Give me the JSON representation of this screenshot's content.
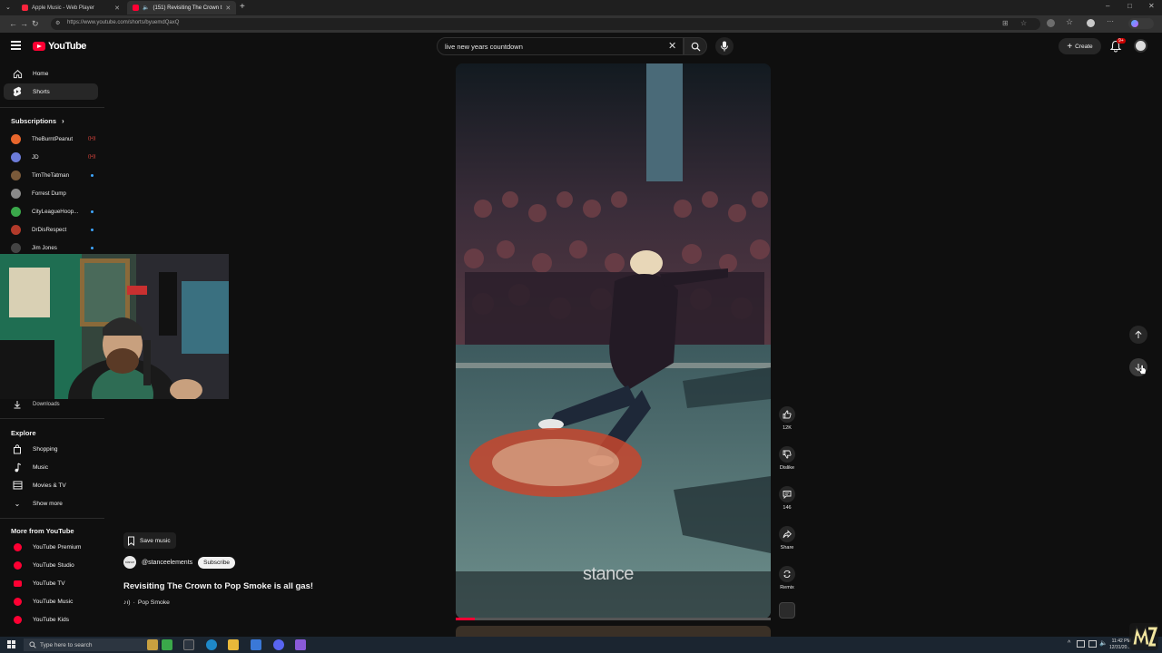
{
  "browser": {
    "tabs": [
      {
        "title": "Apple Music - Web Player",
        "active": false
      },
      {
        "title": "(151) Revisiting The Crown t",
        "active": true
      }
    ],
    "url": "https://www.youtube.com/shorts/byuemdQaxQ",
    "window_controls": [
      "–",
      "□",
      "✕"
    ]
  },
  "header": {
    "logo_text": "YouTube",
    "search_value": "live new years countdown",
    "create_label": "Create",
    "notification_count": "9+"
  },
  "sidebar": {
    "main": [
      {
        "label": "Home",
        "icon": "home-icon"
      },
      {
        "label": "Shorts",
        "icon": "shorts-icon",
        "active": true
      }
    ],
    "subscriptions_heading": "Subscriptions",
    "subscriptions": [
      {
        "name": "TheBurntPeanut",
        "color": "#e8662c",
        "status": "live"
      },
      {
        "name": "JD",
        "color": "#6c7bd8",
        "status": "live"
      },
      {
        "name": "TimTheTatman",
        "color": "#7a5a3a",
        "status": "dot"
      },
      {
        "name": "Forrest Dump",
        "color": "#8a8a8a",
        "status": ""
      },
      {
        "name": "CityLeagueHoop...",
        "color": "#3aa84a",
        "status": "dot"
      },
      {
        "name": "DrDisRespect",
        "color": "#b23a2a",
        "status": "dot"
      },
      {
        "name": "Jim Jones",
        "color": "#444444",
        "status": "dot"
      }
    ],
    "downloads_label": "Downloads",
    "explore_heading": "Explore",
    "explore": [
      {
        "label": "Shopping",
        "icon": "shopping-bag-icon"
      },
      {
        "label": "Music",
        "icon": "music-note-icon"
      },
      {
        "label": "Movies & TV",
        "icon": "film-icon"
      },
      {
        "label": "Show more",
        "icon": "chevron-down-icon"
      }
    ],
    "more_heading": "More from YouTube",
    "more": [
      {
        "label": "YouTube Premium"
      },
      {
        "label": "YouTube Studio"
      },
      {
        "label": "YouTube TV"
      },
      {
        "label": "YouTube Music"
      },
      {
        "label": "YouTube Kids"
      }
    ]
  },
  "short": {
    "watermark": "stance",
    "progress_fraction": 0.06,
    "actions": [
      {
        "name": "like",
        "label": "12K"
      },
      {
        "name": "dislike",
        "label": "Dislike"
      },
      {
        "name": "comments",
        "label": "146"
      },
      {
        "name": "share",
        "label": "Share"
      },
      {
        "name": "remix",
        "label": "Remix"
      }
    ],
    "save_music_label": "Save music",
    "channel_avatar_text": "stance",
    "channel": "@stanceelements",
    "subscribe_label": "Subscribe",
    "title": "Revisiting The Crown to Pop Smoke is all gas!",
    "sound": "Pop Smoke"
  },
  "taskbar": {
    "search_placeholder": "Type here to search",
    "time": "11:42 PM",
    "date": "12/31/20..."
  },
  "colors": {
    "brand_red": "#ff0033",
    "bg": "#0f0f0f",
    "chip": "#272727"
  }
}
